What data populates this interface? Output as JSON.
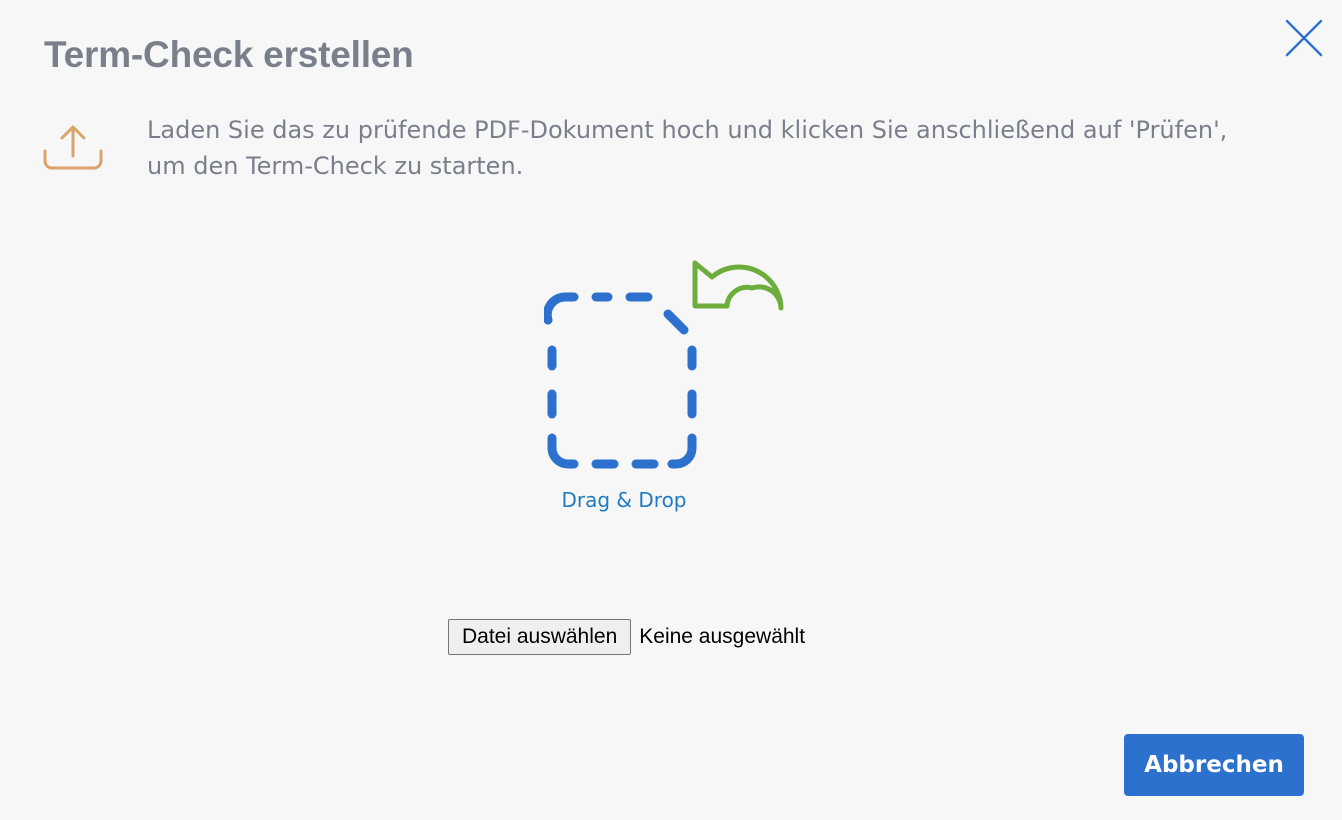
{
  "dialog": {
    "title": "Term-Check erstellen",
    "close_icon": "close-icon"
  },
  "info": {
    "icon": "upload-icon",
    "text": "Laden Sie das zu prüfende PDF-Dokument hoch und klicken Sie anschließend auf 'Prüfen', um den Term-Check zu starten."
  },
  "dropzone": {
    "label": "Drag & Drop",
    "icon": "drag-drop-icon"
  },
  "file_input": {
    "button_label": "Datei auswählen",
    "status": "Keine ausgewählt"
  },
  "footer": {
    "cancel_label": "Abbrechen"
  },
  "colors": {
    "title": "#7a7f8c",
    "upload_icon": "#d9a36a",
    "dropzone_dashes": "#2d71cf",
    "arrow": "#6cad3c",
    "drop_label": "#1f7bc4",
    "primary_button": "#2d71cf",
    "background": "#f7f7f7"
  }
}
